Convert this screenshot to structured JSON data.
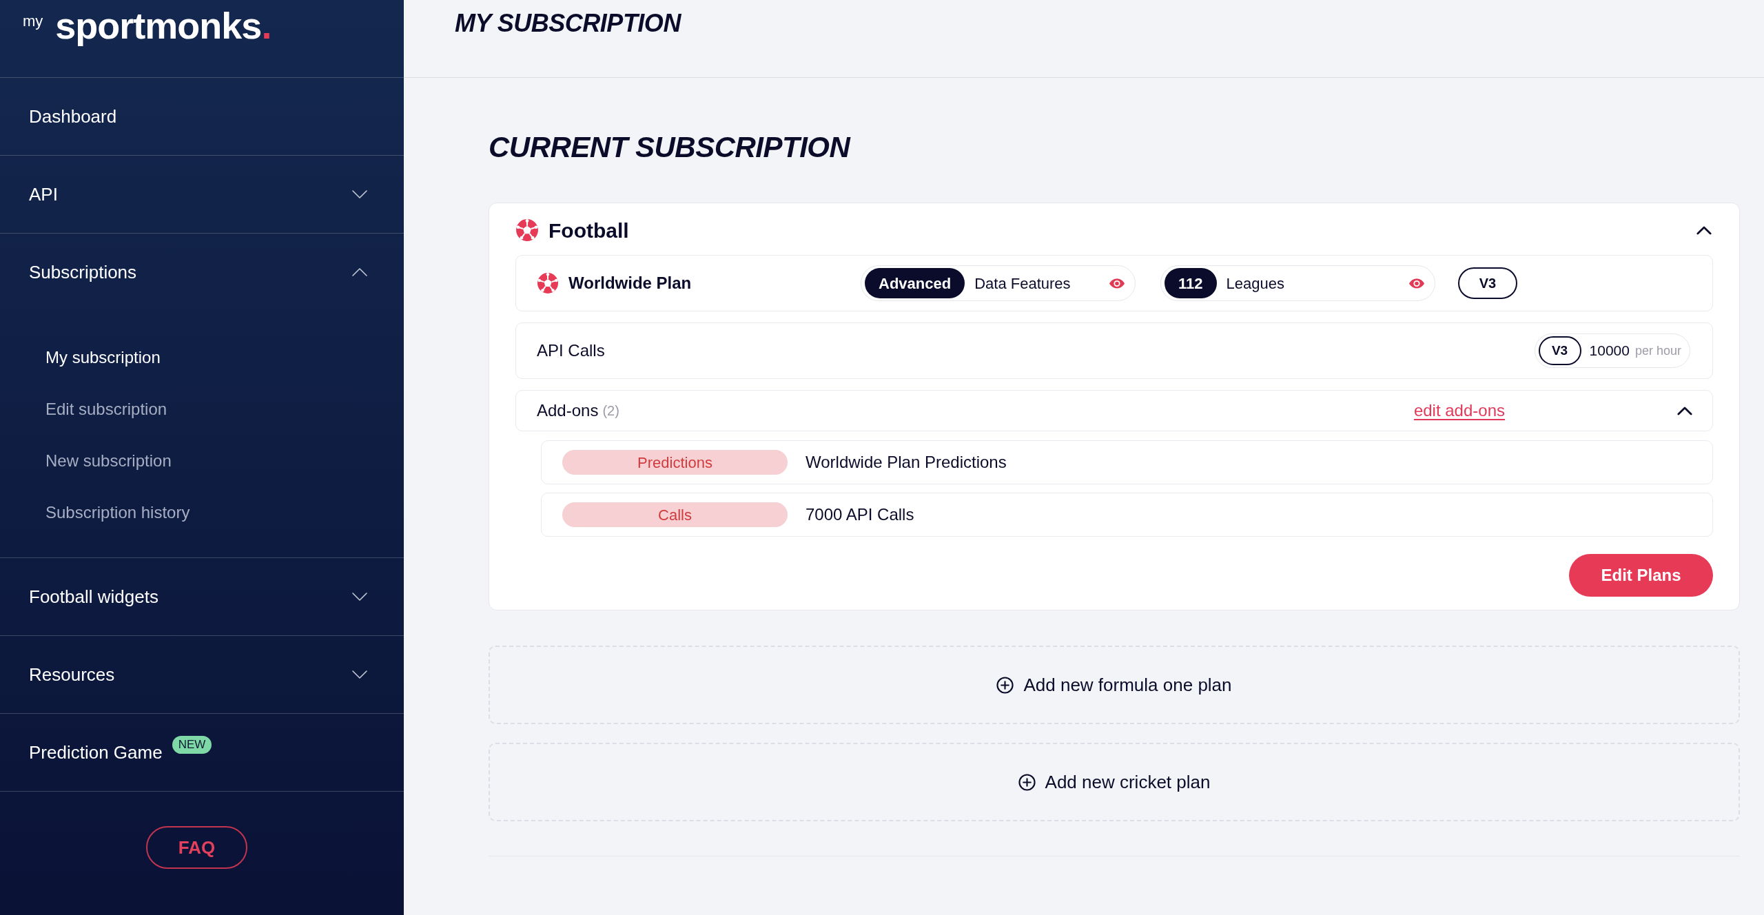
{
  "sidebar": {
    "logo": {
      "prefix": "my",
      "wordmark": "sportmonks."
    },
    "items": [
      {
        "label": "Dashboard",
        "kind": "link"
      },
      {
        "label": "API",
        "kind": "group",
        "expanded": false
      },
      {
        "label": "Subscriptions",
        "kind": "group",
        "expanded": true,
        "children": [
          {
            "label": "My subscription",
            "selected": true
          },
          {
            "label": "Edit subscription",
            "selected": false
          },
          {
            "label": "New subscription",
            "selected": false
          },
          {
            "label": "Subscription history",
            "selected": false
          }
        ]
      },
      {
        "label": "Football widgets",
        "kind": "group",
        "expanded": false
      },
      {
        "label": "Resources",
        "kind": "group",
        "expanded": false
      },
      {
        "label": "Prediction Game",
        "kind": "link",
        "badge": "NEW"
      }
    ],
    "faq_button": "FAQ"
  },
  "page_title": "MY SUBSCRIPTION",
  "section_title": "CURRENT SUBSCRIPTION",
  "subscription": {
    "sport": "Football",
    "expanded": true,
    "plan": {
      "name": "Worldwide Plan",
      "features": [
        {
          "value": "Advanced",
          "label": "Data Features"
        },
        {
          "value": "112",
          "label": "Leagues"
        }
      ],
      "version": "V3"
    },
    "api_calls": {
      "label": "API Calls",
      "version": "V3",
      "value": "10000",
      "unit": "per hour"
    },
    "addons": {
      "label": "Add-ons",
      "count": "(2)",
      "edit_link": "edit add-ons",
      "expanded": true,
      "items": [
        {
          "tag": "Predictions",
          "description": "Worldwide Plan Predictions"
        },
        {
          "tag": "Calls",
          "description": "7000 API Calls"
        }
      ]
    },
    "edit_button": "Edit Plans"
  },
  "add_plan_buttons": [
    "Add new formula one plan",
    "Add new cricket plan"
  ]
}
